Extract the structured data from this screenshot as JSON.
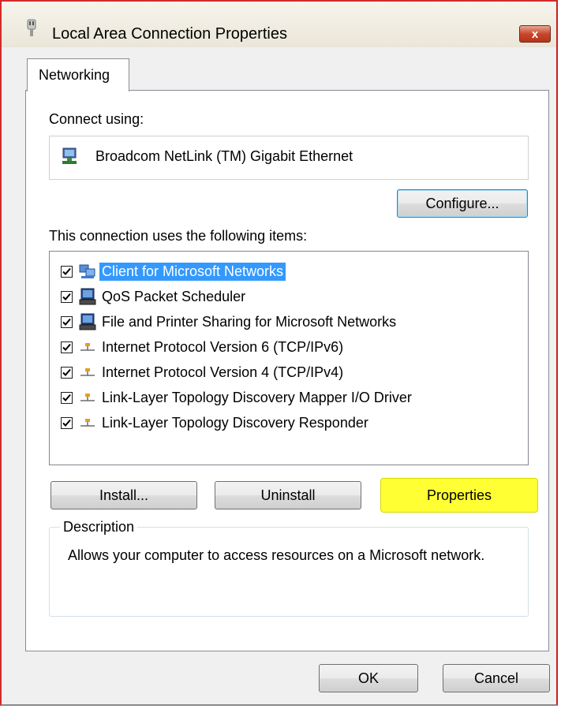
{
  "window": {
    "title": "Local Area Connection Properties",
    "close_label": "x"
  },
  "tabs": [
    {
      "label": "Networking",
      "selected": true
    }
  ],
  "connect_using": {
    "label": "Connect using:",
    "adapter": "Broadcom NetLink (TM) Gigabit Ethernet",
    "configure_label": "Configure..."
  },
  "items_section": {
    "label": "This connection uses the following items:",
    "items": [
      {
        "label": "Client for Microsoft Networks",
        "checked": true,
        "selected": true,
        "icon": "network-client-icon"
      },
      {
        "label": "QoS Packet Scheduler",
        "checked": true,
        "selected": false,
        "icon": "computer-icon"
      },
      {
        "label": "File and Printer Sharing for Microsoft Networks",
        "checked": true,
        "selected": false,
        "icon": "computer-icon"
      },
      {
        "label": "Internet Protocol Version 6 (TCP/IPv6)",
        "checked": true,
        "selected": false,
        "icon": "protocol-icon"
      },
      {
        "label": "Internet Protocol Version 4 (TCP/IPv4)",
        "checked": true,
        "selected": false,
        "icon": "protocol-icon",
        "highlighted": true
      },
      {
        "label": "Link-Layer Topology Discovery Mapper I/O Driver",
        "checked": true,
        "selected": false,
        "icon": "protocol-icon"
      },
      {
        "label": "Link-Layer Topology Discovery Responder",
        "checked": true,
        "selected": false,
        "icon": "protocol-icon"
      }
    ]
  },
  "buttons": {
    "install": "Install...",
    "uninstall": "Uninstall",
    "properties": "Properties",
    "ok": "OK",
    "cancel": "Cancel"
  },
  "description": {
    "legend": "Description",
    "text": "Allows your computer to access resources on a Microsoft network."
  },
  "colors": {
    "highlight": "#ffff33",
    "selection": "#3399ff",
    "window_border": "#d42b2b"
  }
}
